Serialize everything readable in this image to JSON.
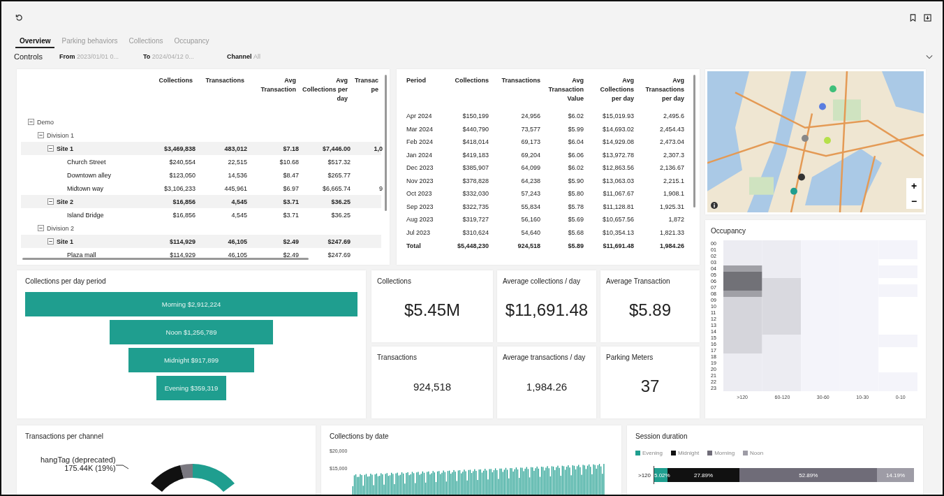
{
  "tabs": [
    {
      "label": "Overview",
      "selected": true
    },
    {
      "label": "Parking behaviors",
      "selected": false
    },
    {
      "label": "Collections",
      "selected": false
    },
    {
      "label": "Occupancy",
      "selected": false
    }
  ],
  "controls": {
    "title": "Controls",
    "filters": [
      {
        "label": "From",
        "value": "2023/01/01 0..."
      },
      {
        "label": "To",
        "value": "2024/04/12 0..."
      },
      {
        "label": "Channel",
        "value": "All"
      }
    ]
  },
  "site_table": {
    "columns": [
      "Collections",
      "Transactions",
      "Avg Transaction",
      "Avg Collections per day",
      "Transac pe"
    ],
    "rows": [
      {
        "label": "Demo",
        "kind": "group",
        "expanded": true,
        "children": [
          {
            "label": "Division 1",
            "kind": "group",
            "expanded": true,
            "children": [
              {
                "label": "Site 1",
                "kind": "subtotal",
                "expanded": true,
                "values": [
                  "$3,469,838",
                  "483,012",
                  "$7.18",
                  "$7,446.00"
                ],
                "cut_value": "1,0",
                "children": [
                  {
                    "label": "Church Street",
                    "kind": "leaf",
                    "values": [
                      "$240,554",
                      "22,515",
                      "$10.68",
                      "$517.32"
                    ]
                  },
                  {
                    "label": "Downtown alley",
                    "kind": "leaf",
                    "values": [
                      "$123,050",
                      "14,536",
                      "$8.47",
                      "$265.77"
                    ]
                  },
                  {
                    "label": "Midtown way",
                    "kind": "leaf",
                    "values": [
                      "$3,106,233",
                      "445,961",
                      "$6.97",
                      "$6,665.74"
                    ],
                    "cut_value": "9"
                  }
                ]
              },
              {
                "label": "Site 2",
                "kind": "subtotal",
                "expanded": true,
                "values": [
                  "$16,856",
                  "4,545",
                  "$3.71",
                  "$36.25"
                ],
                "children": [
                  {
                    "label": "Island Bridge",
                    "kind": "leaf",
                    "values": [
                      "$16,856",
                      "4,545",
                      "$3.71",
                      "$36.25"
                    ]
                  }
                ]
              }
            ]
          },
          {
            "label": "Division 2",
            "kind": "group",
            "expanded": true,
            "children": [
              {
                "label": "Site 1",
                "kind": "subtotal",
                "expanded": true,
                "values": [
                  "$114,929",
                  "46,105",
                  "$2.49",
                  "$247.69"
                ],
                "children": [
                  {
                    "label": "Plaza mall",
                    "kind": "leaf",
                    "values": [
                      "$114,929",
                      "46,105",
                      "$2.49",
                      "$247.69"
                    ]
                  }
                ]
              }
            ]
          }
        ]
      }
    ]
  },
  "period_table": {
    "columns": [
      "Period",
      "Collections",
      "Transactions",
      "Avg Transaction Value",
      "Avg Collections per day",
      "Avg Transactions per day"
    ],
    "rows": [
      [
        "Apr 2024",
        "$150,199",
        "24,956",
        "$6.02",
        "$15,019.93",
        "2,495.6"
      ],
      [
        "Mar 2024",
        "$440,790",
        "73,577",
        "$5.99",
        "$14,693.02",
        "2,454.43"
      ],
      [
        "Feb 2024",
        "$418,014",
        "69,173",
        "$6.04",
        "$14,929.08",
        "2,473.04"
      ],
      [
        "Jan 2024",
        "$419,183",
        "69,204",
        "$6.06",
        "$13,972.78",
        "2,307.3"
      ],
      [
        "Dec 2023",
        "$385,907",
        "64,099",
        "$6.02",
        "$12,863.56",
        "2,136.67"
      ],
      [
        "Nov 2023",
        "$378,828",
        "64,238",
        "$5.90",
        "$13,063.03",
        "2,215.1"
      ],
      [
        "Oct 2023",
        "$332,030",
        "57,243",
        "$5.80",
        "$11,067.67",
        "1,908.1"
      ],
      [
        "Sep 2023",
        "$322,735",
        "55,834",
        "$5.78",
        "$11,128.81",
        "1,925.31"
      ],
      [
        "Aug 2023",
        "$319,727",
        "56,160",
        "$5.69",
        "$10,657.56",
        "1,872"
      ],
      [
        "Jul 2023",
        "$310,624",
        "54,640",
        "$5.68",
        "$10,354.13",
        "1,821.33"
      ]
    ],
    "total": [
      "Total",
      "$5,448,230",
      "924,518",
      "$5.89",
      "$11,691.48",
      "1,984.26"
    ]
  },
  "map": {
    "zoom_in": "+",
    "zoom_out": "−"
  },
  "occupancy": {
    "title": "Occupancy",
    "hours": [
      "00",
      "01",
      "02",
      "03",
      "04",
      "05",
      "06",
      "07",
      "08",
      "09",
      "10",
      "11",
      "12",
      "13",
      "14",
      "15",
      "16",
      "17",
      "18",
      "19",
      "20",
      "21",
      "22",
      "23"
    ],
    "buckets": [
      ">120",
      "60-120",
      "30-60",
      "10-30",
      "0-10"
    ]
  },
  "funnel": {
    "title": "Collections per day period",
    "items": [
      {
        "label": "Morning $2,912,224"
      },
      {
        "label": "Noon $1,256,789"
      },
      {
        "label": "Midnight $917,899"
      },
      {
        "label": "Evening $359,319"
      }
    ]
  },
  "kpis": [
    {
      "title": "Collections",
      "value": "$5.45M"
    },
    {
      "title": "Average collections / day",
      "value": "$11,691.48"
    },
    {
      "title": "Average Transaction",
      "value": "$5.89"
    },
    {
      "title": "Transactions",
      "value": "924,518"
    },
    {
      "title": "Average transactions / day",
      "value": "1,984.26"
    },
    {
      "title": "Parking Meters",
      "value": "37"
    }
  ],
  "channels": {
    "title": "Transactions per channel",
    "callout": {
      "label": "hangTag (deprecated)",
      "value": "175.44K (19%)"
    }
  },
  "by_date": {
    "title": "Collections by date",
    "y_ticks": [
      "$20,000",
      "$15,000"
    ]
  },
  "session": {
    "title": "Session duration",
    "chart_data": {
      "type": "bar",
      "orientation": "horizontal",
      "stacked": true,
      "categories": [
        ">120"
      ],
      "series": [
        {
          "name": "Evening",
          "color": "#1f9e8f",
          "values": [
            5.02
          ],
          "value_labels": [
            "5.02%"
          ]
        },
        {
          "name": "Midnight",
          "color": "#111111",
          "values": [
            27.89
          ],
          "value_labels": [
            "27.89%"
          ]
        },
        {
          "name": "Morning",
          "color": "#6f6c78",
          "values": [
            52.89
          ],
          "value_labels": [
            "52.89%"
          ]
        },
        {
          "name": "Noon",
          "color": "#9e9ca6",
          "values": [
            14.19
          ],
          "value_labels": [
            "14.19%"
          ]
        }
      ]
    }
  }
}
